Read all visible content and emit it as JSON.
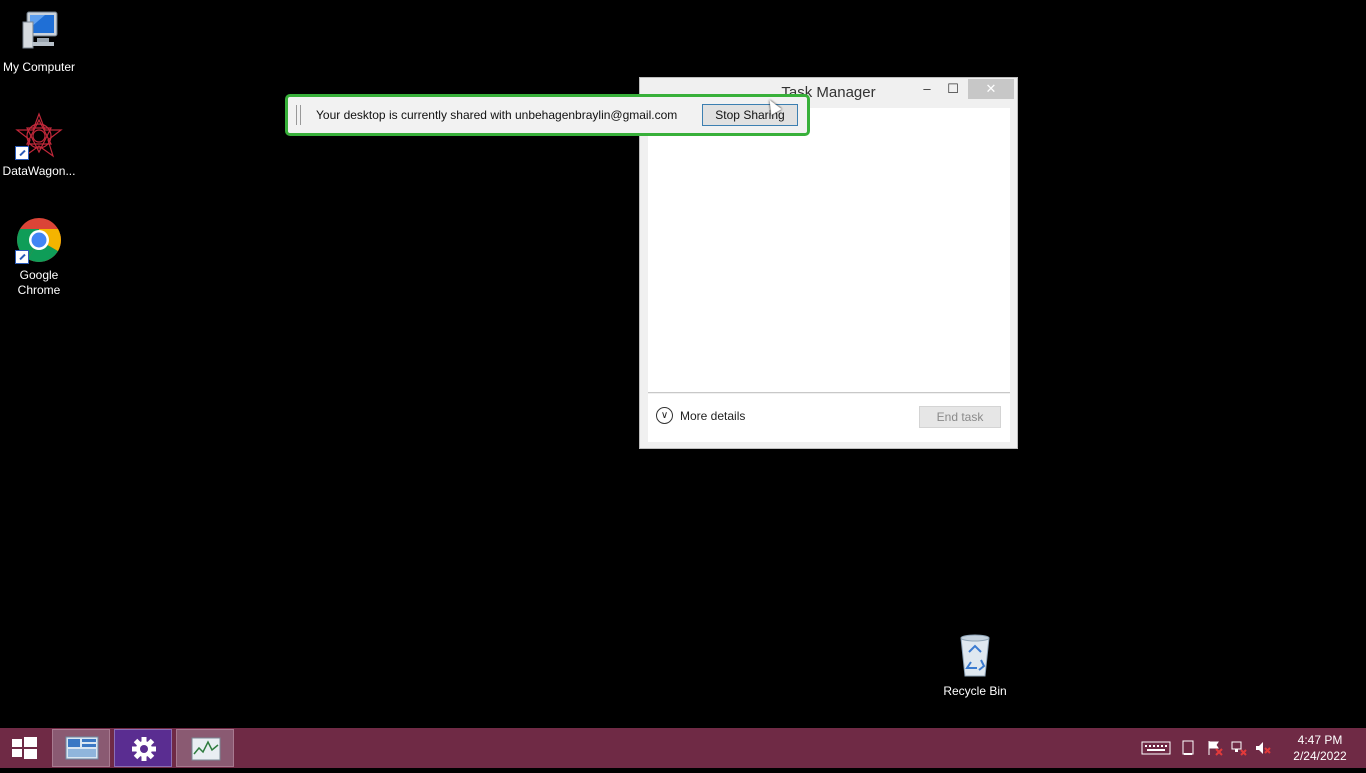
{
  "desktop": {
    "icons": [
      {
        "label": "My Computer"
      },
      {
        "label": "DataWagon..."
      },
      {
        "label": "Google Chrome"
      },
      {
        "label": "Recycle Bin"
      }
    ]
  },
  "task_manager": {
    "title": "Task Manager",
    "minimize_glyph": "–",
    "maximize_glyph": "☐",
    "close_glyph": "✕",
    "more_details_label": "More details",
    "end_task_label": "End task"
  },
  "share_bar": {
    "message": "Your desktop is currently shared with unbehagenbraylin@gmail.com",
    "stop_label": "Stop Sharing"
  },
  "taskbar": {
    "apps": [
      {
        "icon": "server-manager-icon"
      },
      {
        "icon": "settings-gear-icon"
      },
      {
        "icon": "task-manager-icon"
      }
    ],
    "tray_icons": [
      "keyboard-icon",
      "tablet-icon",
      "flag-icon",
      "network-icon",
      "volume-muted-icon"
    ],
    "time": "4:47 PM",
    "date": "2/24/2022"
  },
  "colors": {
    "taskbar": "#6f2a45",
    "share_border": "#38b03a",
    "settings_tile": "#5a2d91"
  }
}
